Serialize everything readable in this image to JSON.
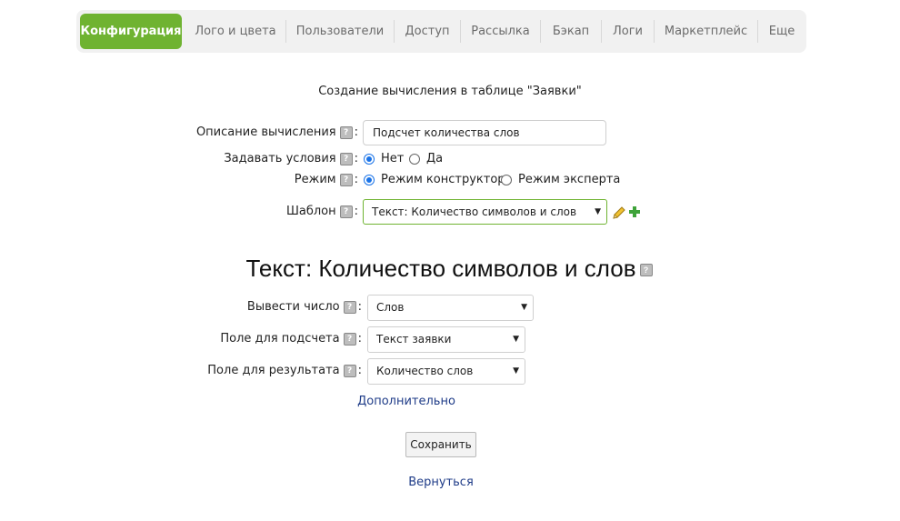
{
  "tabs": [
    {
      "label": "Конфигурация",
      "active": true
    },
    {
      "label": "Лого и цвета"
    },
    {
      "label": "Пользователи"
    },
    {
      "label": "Доступ"
    },
    {
      "label": "Рассылка"
    },
    {
      "label": "Бэкап"
    },
    {
      "label": "Логи"
    },
    {
      "label": "Маркетплейс"
    },
    {
      "label": "Еще"
    }
  ],
  "page": {
    "heading": "Создание вычисления в таблице \"Заявки\""
  },
  "form": {
    "description": {
      "label": "Описание вычисления",
      "value": "Подсчет количества слов"
    },
    "conditions": {
      "label": "Задавать условия",
      "options": [
        "Нет",
        "Да"
      ],
      "selected": "Нет"
    },
    "mode": {
      "label": "Режим",
      "options": [
        "Режим конструктора",
        "Режим эксперта"
      ],
      "selected": "Режим конструктора"
    },
    "template": {
      "label": "Шаблон",
      "value": "Текст: Количество символов и слов"
    },
    "colon": ":",
    "help_glyph": "?"
  },
  "template_section": {
    "title": "Текст: Количество символов и слов",
    "output": {
      "label": "Вывести число",
      "value": "Слов"
    },
    "count_field": {
      "label": "Поле для подсчета",
      "value": "Текст заявки"
    },
    "result_field": {
      "label": "Поле для результата",
      "value": "Количество слов"
    },
    "more_link": "Дополнительно"
  },
  "actions": {
    "save": "Сохранить",
    "back": "Вернуться"
  },
  "colors": {
    "accent": "#6fb331",
    "link": "#1f3c88",
    "radio": "#1a73e8"
  },
  "icons": {
    "edit": "pencil-icon",
    "add": "plus-icon",
    "help": "help-icon",
    "dropdown": "chevron-down-icon"
  }
}
